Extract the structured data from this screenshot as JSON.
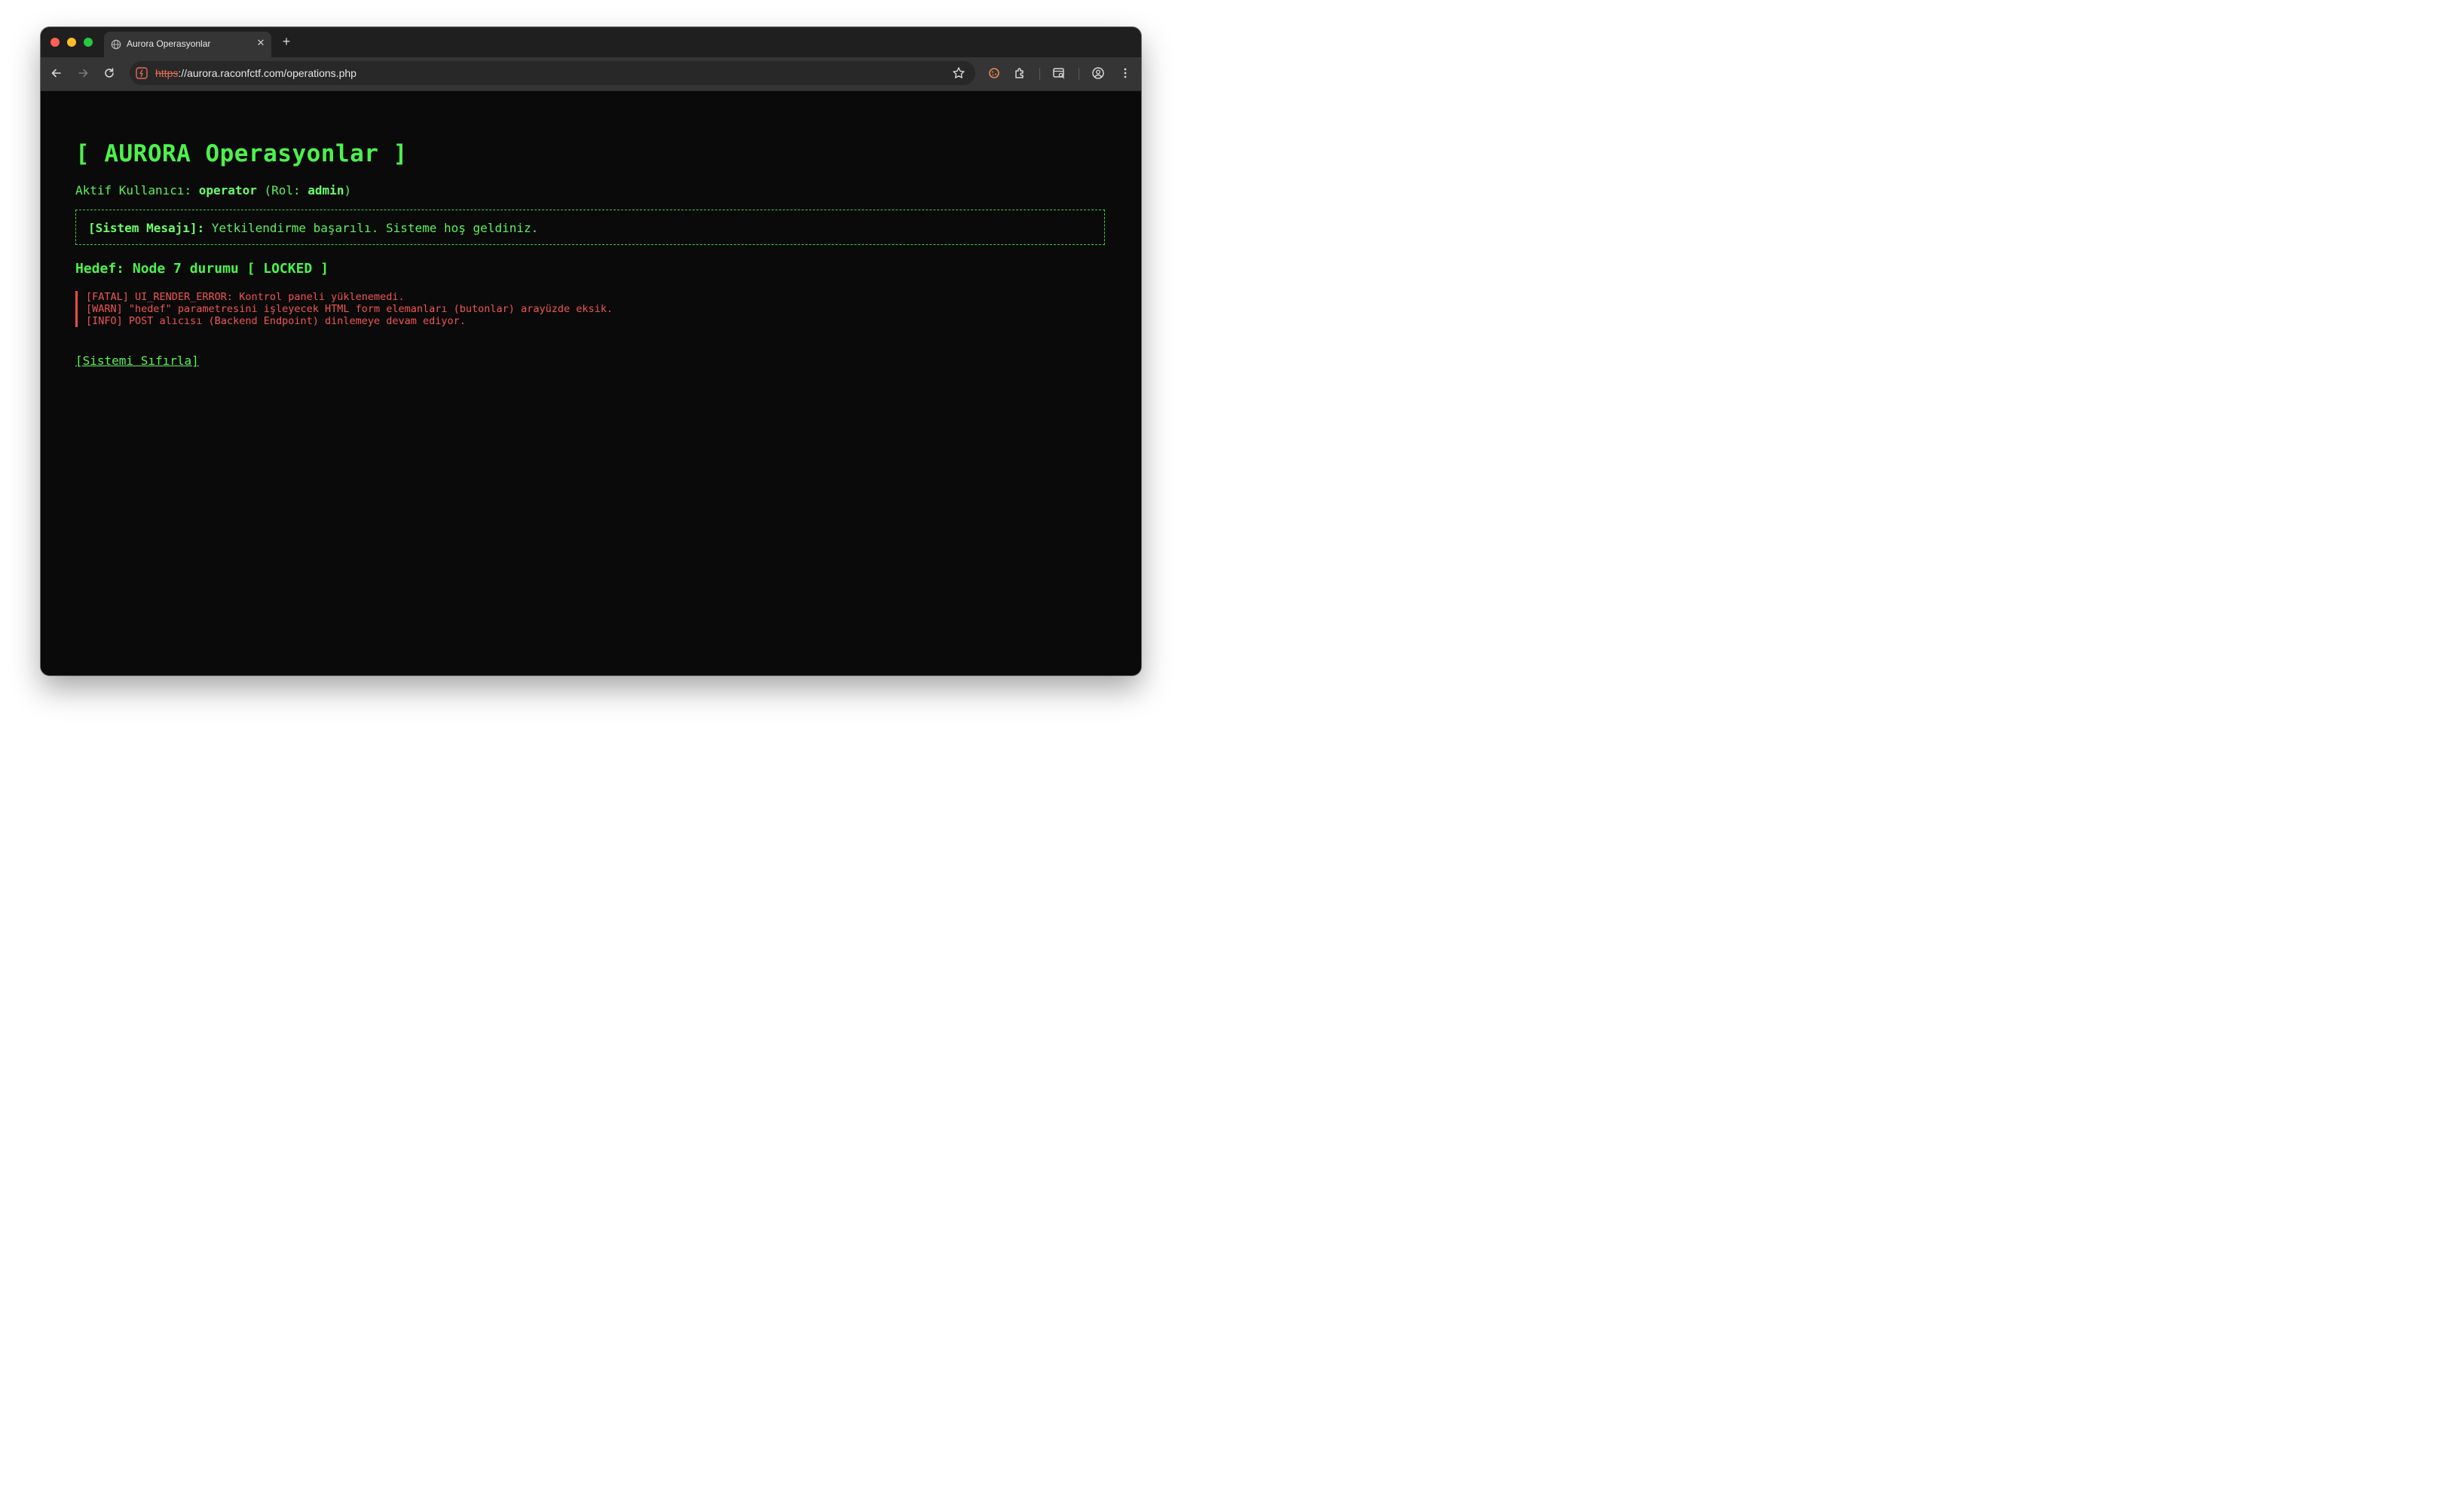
{
  "browser": {
    "tab": {
      "title": "Aurora Operasyonlar",
      "favicon": "globe-icon",
      "close_glyph": "✕"
    },
    "new_tab_glyph": "+",
    "url": {
      "scheme": "https",
      "rest": "://aurora.raconfctf.com/operations.php"
    },
    "colors": {
      "tab_strip": "#1f1f1f",
      "toolbar": "#353535",
      "insecure_scheme": "#e36b56"
    }
  },
  "page": {
    "title": "[ AURORA Operasyonlar ]",
    "active_user": {
      "label": "Aktif Kullanıcı:",
      "username": "operator",
      "role_open": "(Rol:",
      "role": "admin",
      "role_close": ")"
    },
    "system_message": {
      "label": "[Sistem Mesajı]:",
      "text": "Yetkilendirme başarılı. Sisteme hoş geldiniz."
    },
    "target_status": "Hedef: Node 7 durumu [ LOCKED ]",
    "logs": [
      "[FATAL] UI_RENDER_ERROR: Kontrol paneli yüklenemedi.",
      "[WARN] \"hedef\" parametresini işleyecek HTML form elemanları (butonlar) arayüzde eksik.",
      "[INFO] POST alıcısı (Backend Endpoint) dinlemeye devam ediyor."
    ],
    "reset_link": "[Sistemi Sıfırla]",
    "colors": {
      "background": "#0a0a0a",
      "accent_green": "#4cf24c",
      "error_red": "#f05555"
    }
  }
}
